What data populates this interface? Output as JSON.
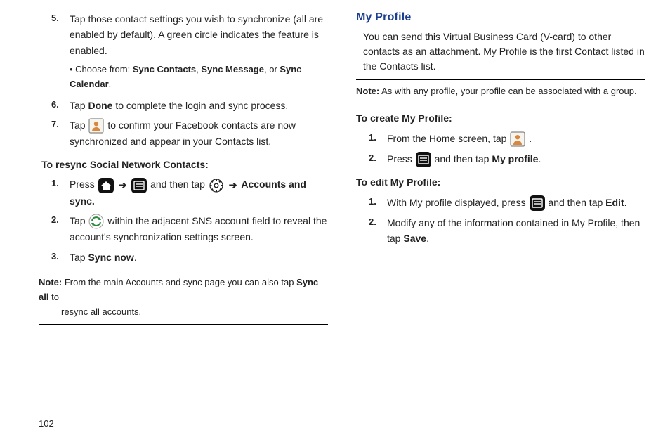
{
  "left": {
    "step5": {
      "num": "5.",
      "text_a": "Tap those contact settings you wish to synchronize (all are enabled by default). A green circle indicates the feature is enabled."
    },
    "bullet": {
      "prefix": "Choose from: ",
      "b1": "Sync Contacts",
      "sep1": ", ",
      "b2": "Sync Message",
      "sep2": ", or ",
      "b3": "Sync Calendar",
      "tail": "."
    },
    "step6": {
      "num": "6.",
      "t1": "Tap ",
      "b": "Done",
      "t2": " to complete the login and sync process."
    },
    "step7": {
      "num": "7.",
      "t1": "Tap ",
      "t2": " to confirm your Facebook contacts are now synchronized and appear in your Contacts list."
    },
    "resync_head": "To resync Social Network Contacts:",
    "r1": {
      "num": "1.",
      "t1": "Press ",
      "t2": " and then tap ",
      "b": "Accounts and sync."
    },
    "r2": {
      "num": "2.",
      "t1": "Tap ",
      "t2": " within the adjacent SNS account field to reveal the account's synchronization settings screen."
    },
    "r3": {
      "num": "3.",
      "t1": "Tap ",
      "b": "Sync now",
      "t2": "."
    },
    "note": {
      "label": "Note:",
      "t1": " From the main Accounts and sync page you can also tap ",
      "b": "Sync all",
      "t2": " to ",
      "t3": "resync all accounts."
    }
  },
  "right": {
    "title": "My Profile",
    "intro": "You can send this Virtual Business Card (V-card) to other contacts as an attachment. My Profile is the first Contact listed in the Contacts list.",
    "note": {
      "label": "Note:",
      "t": " As with any profile, your profile can be associated with a group."
    },
    "create_head": "To create My Profile:",
    "c1": {
      "num": "1.",
      "t1": "From the Home screen, tap ",
      "t2": " ."
    },
    "c2": {
      "num": "2.",
      "t1": "Press ",
      "t2": " and then tap ",
      "b": "My profile",
      "t3": "."
    },
    "edit_head": "To edit My Profile:",
    "e1": {
      "num": "1.",
      "t1": "With My profile displayed, press ",
      "t2": " and then tap ",
      "b": "Edit",
      "t3": "."
    },
    "e2": {
      "num": "2.",
      "t1": "Modify any of the information contained in My Profile, then tap ",
      "b": "Save",
      "t2": "."
    }
  },
  "page_number": "102",
  "arrow": "➔"
}
